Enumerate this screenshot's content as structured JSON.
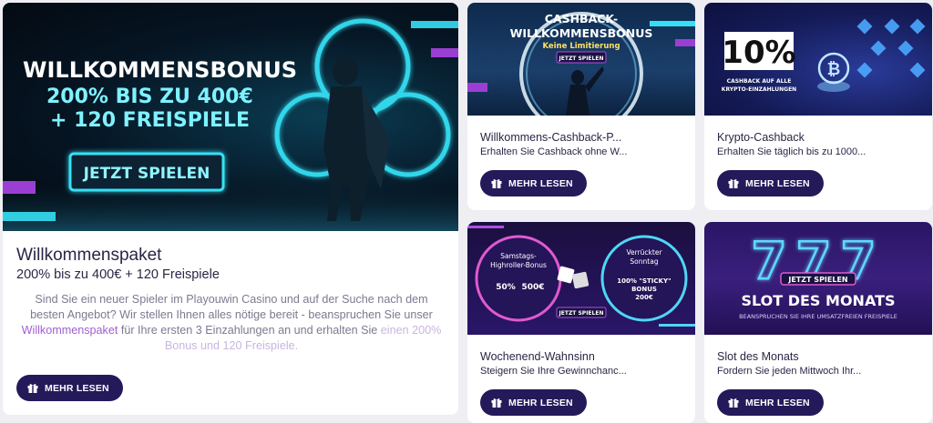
{
  "main": {
    "banner": {
      "headline1": "WILLKOMMENSBONUS",
      "headline2": "200% BIS ZU 400€",
      "headline3": "+ 120 FREISPIELE",
      "cta": "JETZT SPIELEN"
    },
    "title": "Willkommenspaket",
    "subtitle": "200% bis zu 400€ + 120 Freispiele",
    "desc_part1": "Sind Sie ein neuer Spieler im Playouwin Casino und auf der Suche nach dem besten Angebot? Wir stellen Ihnen alles nötige bereit - beanspruchen Sie unser ",
    "desc_link": "Willkommenspaket",
    "desc_part2": " für Ihre ersten 3 Einzahlungen an und erhalten Sie ",
    "desc_fade": "einen 200% Bonus und 120 Freispiele.",
    "button": "MEHR LESEN"
  },
  "cards": [
    {
      "banner": {
        "line1": "CASHBACK-",
        "line2": "WILLKOMMENSBONUS",
        "line3": "Keine Limitierung",
        "cta": "JETZT SPIELEN"
      },
      "title": "Willkommens-Cashback-P...",
      "subtitle": "Erhalten Sie Cashback ohne W...",
      "button": "MEHR LESEN"
    },
    {
      "banner": {
        "big": "10%",
        "line1": "CASHBACK AUF ALLE",
        "line2": "KRYPTO-EINZAHLUNGEN"
      },
      "title": "Krypto-Cashback",
      "subtitle": "Erhalten Sie täglich bis zu 1000...",
      "button": "MEHR LESEN"
    },
    {
      "banner": {
        "left_title1": "Samstags-",
        "left_title2": "Highroller-Bonus",
        "left_pct": "50%",
        "left_amt": "500€",
        "right_title1": "Verrückter",
        "right_title2": "Sonntag",
        "right_pct": "100% \"STICKY\"",
        "right_word": "BONUS",
        "right_amt": "200€",
        "cta": "JETZT SPIELEN"
      },
      "title": "Wochenend-Wahnsinn",
      "subtitle": "Steigern Sie Ihre Gewinnchanc...",
      "button": "MEHR LESEN"
    },
    {
      "banner": {
        "sevens": "777",
        "cta": "JETZT SPIELEN",
        "headline": "SLOT DES MONATS",
        "tagline": "BEANSPRUCHEN SIE IHRE UMSATZFREIEN FREISPIELE"
      },
      "title": "Slot des Monats",
      "subtitle": "Fordern Sie jeden Mittwoch Ihr...",
      "button": "MEHR LESEN"
    }
  ],
  "colors": {
    "button_bg": "#241a5a",
    "link": "#a15fd0",
    "neon_cyan": "#35e0f5",
    "neon_purple": "#b04fe0"
  },
  "icons": {
    "button_icon": "gift-icon"
  }
}
